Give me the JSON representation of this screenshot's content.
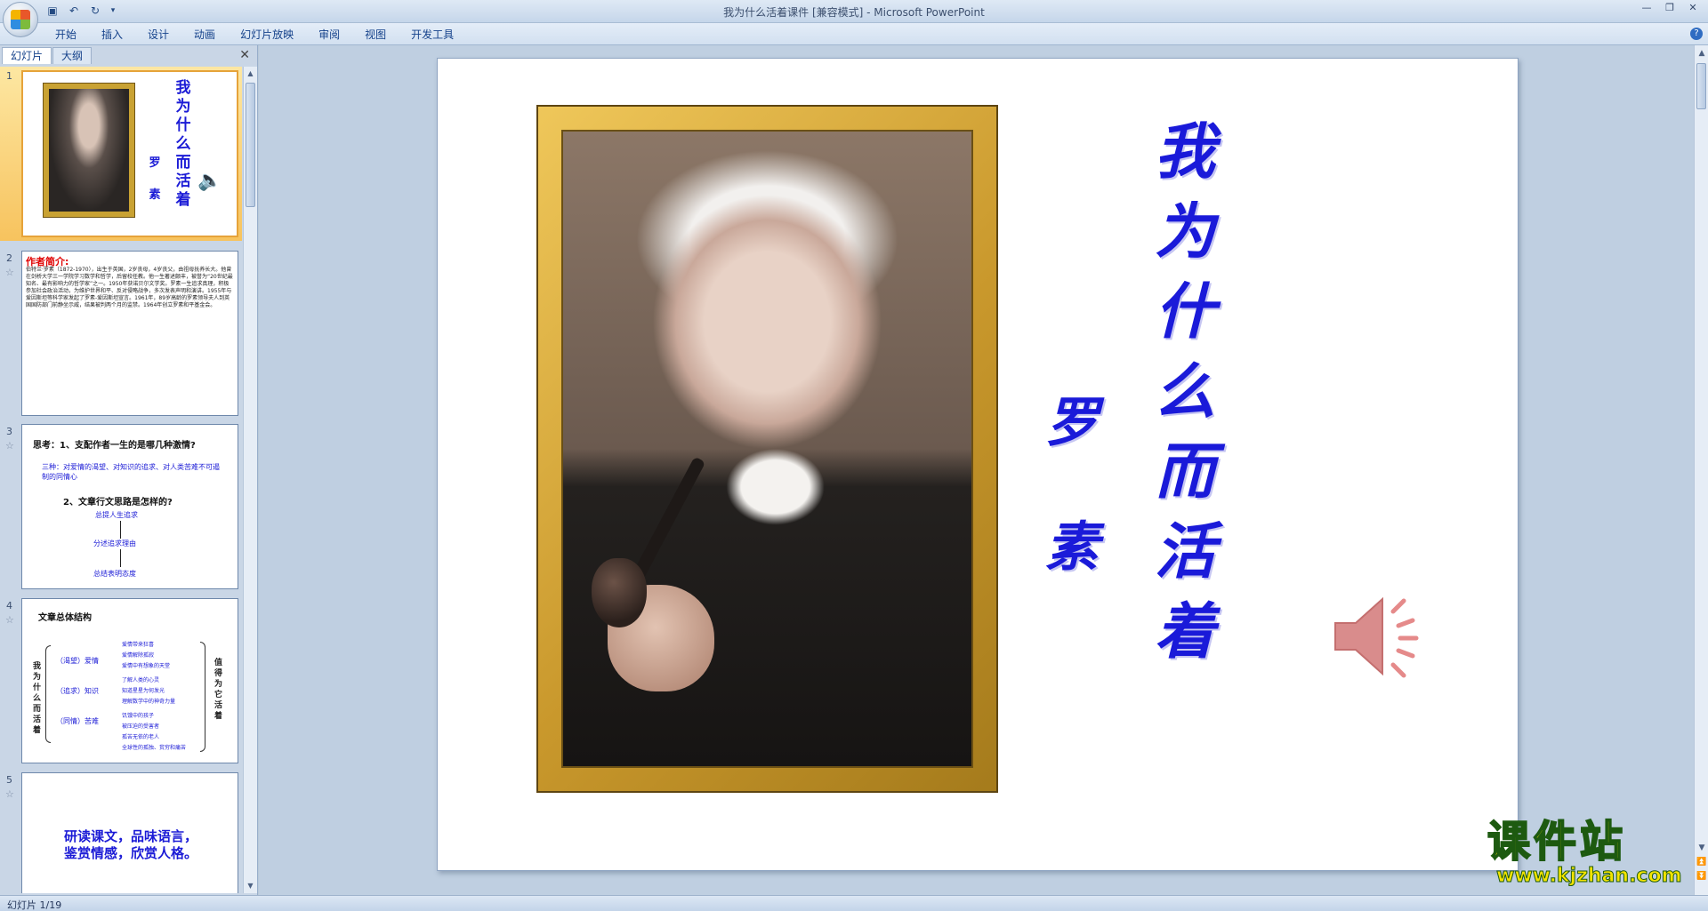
{
  "window": {
    "title": "我为什么活着课件 [兼容模式] - Microsoft PowerPoint"
  },
  "qat": {
    "save_icon": "save-icon",
    "undo_icon": "undo-icon",
    "redo_icon": "redo-icon"
  },
  "ribbon": {
    "tabs": [
      "开始",
      "插入",
      "设计",
      "动画",
      "幻灯片放映",
      "审阅",
      "视图",
      "开发工具"
    ]
  },
  "pane": {
    "tabs": [
      "幻灯片",
      "大纲"
    ],
    "close_label": "✕"
  },
  "thumbnails": {
    "slide1": {
      "num": "1",
      "title": "我为什么而活着",
      "author": "罗素"
    },
    "slide2": {
      "num": "2",
      "heading": "作者简介:",
      "body": "伯特兰·罗素（1872-1970），出生于英国，2岁丧母，4岁丧父，由祖母抚养长大。他曾在剑桥大学三一学院学习数学和哲学，后留校任教。他一生著述颇丰，被誉为“20世纪最知名、最有影响力的哲学家”之一。1950年获诺贝尔文学奖。罗素一生追求真理，积极参加社会政治活动，为维护世界和平、反对侵略战争，多次发表声明和演讲。1955年与爱因斯坦等科学家发起了罗素-爱因斯坦宣言。1961年，89岁高龄的罗素领导夫人到英国国防部门前静坐示威，结果被判两个月的监禁。1964年创立罗素和平基金会。"
    },
    "slide3": {
      "num": "3",
      "q1": "思考：1、支配作者一生的是哪几种激情?",
      "a1": "三种：对爱情的渴望、对知识的追求、对人类苦难不可遏制的同情心",
      "q2": "2、文章行文思路是怎样的?",
      "s1": "总提人生追求",
      "s2": "分述追求理由",
      "s3": "总结表明态度"
    },
    "slide4": {
      "num": "4",
      "heading": "文章总体结构",
      "left": "我为什么而活着",
      "mid1": "（渴望）爱情",
      "mid2": "（追求）知识",
      "mid3": "（同情）苦难",
      "items": [
        "爱情带来狂喜",
        "爱情解除孤寂",
        "爱情中有想象的天堂",
        "了解人类的心灵",
        "知道星星为何发光",
        "理解数学中的神奇力量",
        "饥饿中的孩子",
        "被压迫的受害者",
        "孤苦无依的老人",
        "全球性的孤独、贫穷和痛苦"
      ],
      "right": "值得为它活着"
    },
    "slide5": {
      "num": "5",
      "line1": "研读课文，品味语言，",
      "line2": "鉴赏情感，欣赏人格。"
    }
  },
  "slide": {
    "title": "我为什么而活着",
    "author": "罗素",
    "speaker_icon": "speaker-icon"
  },
  "watermark": {
    "main": "课件站",
    "url": "www.kjzhan.com"
  },
  "status": {
    "text": "幻灯片 1/19"
  },
  "colors": {
    "title_blue": "#1a1ad9",
    "frame_gold": "#c9982c",
    "heading_red": "#e00000"
  }
}
